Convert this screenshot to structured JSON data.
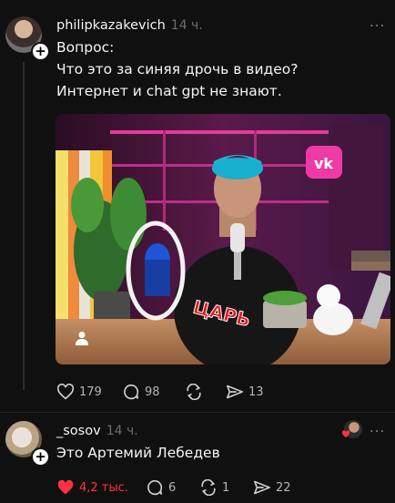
{
  "post": {
    "username": "philipkazakevich",
    "time": "14 ч.",
    "more": "...",
    "lines": [
      "Вопрос:",
      "Что это за синяя дрочь в видео?",
      "Интернет и chat gpt не знают."
    ],
    "video_caption": "ЦАРЬ",
    "video_logo": "vk",
    "stats": {
      "likes": "179",
      "comments": "98",
      "reposts": "",
      "shares": "13"
    }
  },
  "reply": {
    "username": "_sosov",
    "time": "14 ч.",
    "more": "...",
    "text": "Это Артемий Лебедев",
    "stats": {
      "likes": "4,2 тыс.",
      "comments": "6",
      "reposts": "1",
      "shares": "22"
    }
  },
  "colors": {
    "background": "#101010",
    "like_red": "#ff3040",
    "muted": "#6b6b6b"
  }
}
